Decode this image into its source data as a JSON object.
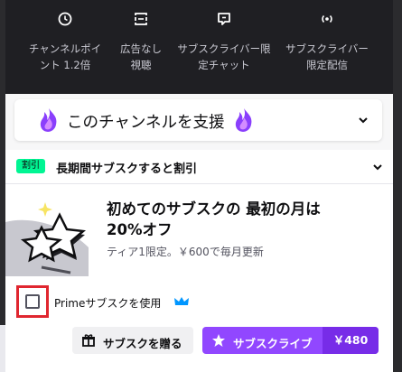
{
  "benefits": [
    {
      "icon": "channel-points-icon",
      "line1": "チャンネルポイ",
      "line2": "ント 1.2倍"
    },
    {
      "icon": "ad-free-icon",
      "line1": "広告なし",
      "line2": "視聴"
    },
    {
      "icon": "sub-only-chat-icon",
      "line1": "サブスクライバー限",
      "line2": "定チャット"
    },
    {
      "icon": "sub-only-stream-icon",
      "line1": "サブスクライバー",
      "line2": "限定配信"
    }
  ],
  "support": {
    "title": "このチャンネルを支援"
  },
  "card": {
    "badge": "割引",
    "header": "長期間サブスクすると割引",
    "offer_title_1": "初めてのサブスクの 最初の月は",
    "offer_title_2": "20%オフ",
    "offer_sub": "ティア1限定。￥600で毎月更新",
    "prime_label": "Primeサブスクを使用",
    "gift_label": "サブスクを贈る",
    "subscribe_label": "サブスクライブ",
    "price": "￥480"
  },
  "colors": {
    "accent": "#9147ff",
    "accent_dark": "#772ce8",
    "badge": "#00f593",
    "highlight": "#e0262f",
    "prime": "#0096ff"
  }
}
